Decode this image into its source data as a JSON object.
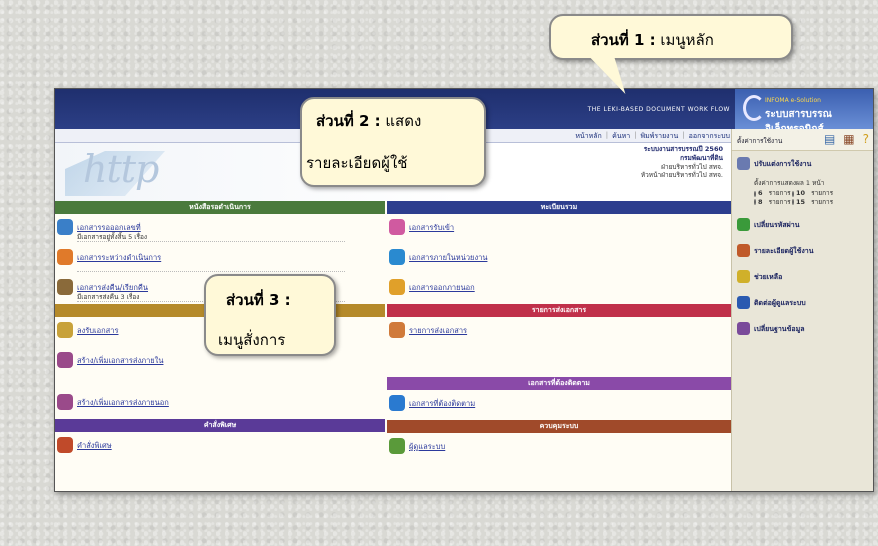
{
  "topbar": {
    "system_title": "THE LEKI-BASED DOCUMENT WORK FLOW"
  },
  "logo": {
    "line1": "INFOMA e-Solution",
    "line2": "ระบบสารบรรณอิเล็กทรอนิกส์"
  },
  "menubar": {
    "items": [
      "หน้าหลัก",
      "ค้นหา",
      "พิมพ์รายงาน",
      "ออกจากระบบ"
    ]
  },
  "userinfo": {
    "line1": "ระบบงานสารบรรณปี 2560",
    "line2": "กรมพัฒนาที่ดิน",
    "line3": "ฝ่ายบริหารทั่วไป สทจ.",
    "line4": "หัวหน้าฝ่ายบริหารทั่วไป สทจ."
  },
  "banner": {
    "text": "http"
  },
  "left": {
    "header1": "หนังสือรอดำเนินการ",
    "items1": [
      {
        "label": "เอกสารรอออกเลขที่",
        "sub": "มีเอกสารอยู่ทั้งสิ้น 5 เรื่อง",
        "color": "#3a7fc8"
      },
      {
        "label": "เอกสารระหว่างดำเนินการ",
        "sub": "",
        "color": "#e07a2a"
      },
      {
        "label": "เอกสารส่งคืน/เรียกคืน",
        "sub": "มีเอกสารส่งคืน 3 เรื่อง",
        "color": "#8a6a3a"
      }
    ],
    "header2": "สั่งการ",
    "items2": [
      {
        "label": "ลงรับเอกสาร",
        "color": "#c8a23a"
      },
      {
        "label": "สร้าง/เพิ่มเอกสารส่งภายใน",
        "color": "#9a4a8a"
      },
      {
        "label": "สร้าง/เพิ่มเอกสารส่งภายนอก",
        "color": "#9a4a8a"
      }
    ],
    "header3": "คำสั่งพิเศษ",
    "items3": [
      {
        "label": "คำสั่งพิเศษ",
        "color": "#c04a2a"
      }
    ]
  },
  "right": {
    "header1": "ทะเบียนรวม",
    "items1": [
      {
        "label": "เอกสารรับเข้า",
        "color": "#d05aa0"
      },
      {
        "label": "เอกสารภายในหน่วยงาน",
        "color": "#2a8ad0"
      },
      {
        "label": "เอกสารออกภายนอก",
        "color": "#e0a02a"
      }
    ],
    "header2": "รายการส่งเอกสาร",
    "items2": [
      {
        "label": "รายการส่งเอกสาร",
        "color": "#d07a3a"
      }
    ],
    "header3": "เอกสารที่ต้องติดตาม",
    "items3": [
      {
        "label": "เอกสารที่ต้องติดตาม",
        "color": "#2a7ad0"
      }
    ],
    "header4": "ควบคุมระบบ",
    "items4": [
      {
        "label": "ผู้ดูแลระบบ",
        "color": "#5a9a3a"
      }
    ]
  },
  "sidebar": {
    "top_label": "ตั้งค่าการใช้งาน",
    "setting_label": "ปรับแต่งการใช้งาน",
    "setting_sub": "ตั้งค่าการแสดงผล 1 หน้า",
    "radio": [
      {
        "n": "6",
        "unit": "รายการ",
        "on": true
      },
      {
        "n": "10",
        "unit": "รายการ",
        "on": false
      },
      {
        "n": "8",
        "unit": "รายการ",
        "on": false
      },
      {
        "n": "15",
        "unit": "รายการ",
        "on": false
      }
    ],
    "items": [
      {
        "label": "เปลี่ยนรหัสผ่าน",
        "color": "#3a9a3a"
      },
      {
        "label": "รายละเอียดผู้ใช้งาน",
        "color": "#c05a2a"
      },
      {
        "label": "ช่วยเหลือ",
        "color": "#d0b02a"
      },
      {
        "label": "ติดต่อผู้ดูแลระบบ",
        "color": "#2a5ab0"
      },
      {
        "label": "เปลี่ยนฐานข้อมูล",
        "color": "#7a4a9a"
      }
    ]
  },
  "callouts": {
    "c1": {
      "bold": "ส่วนที่ 1 :",
      "text": " เมนูหลัก"
    },
    "c2": {
      "bold": "ส่วนที่ 2 :",
      "text": " แสดง",
      "line2": "รายละเอียดผู้ใช้"
    },
    "c3": {
      "bold": "ส่วนที่ 3 :",
      "line2": "เมนูสั่งการ"
    }
  }
}
